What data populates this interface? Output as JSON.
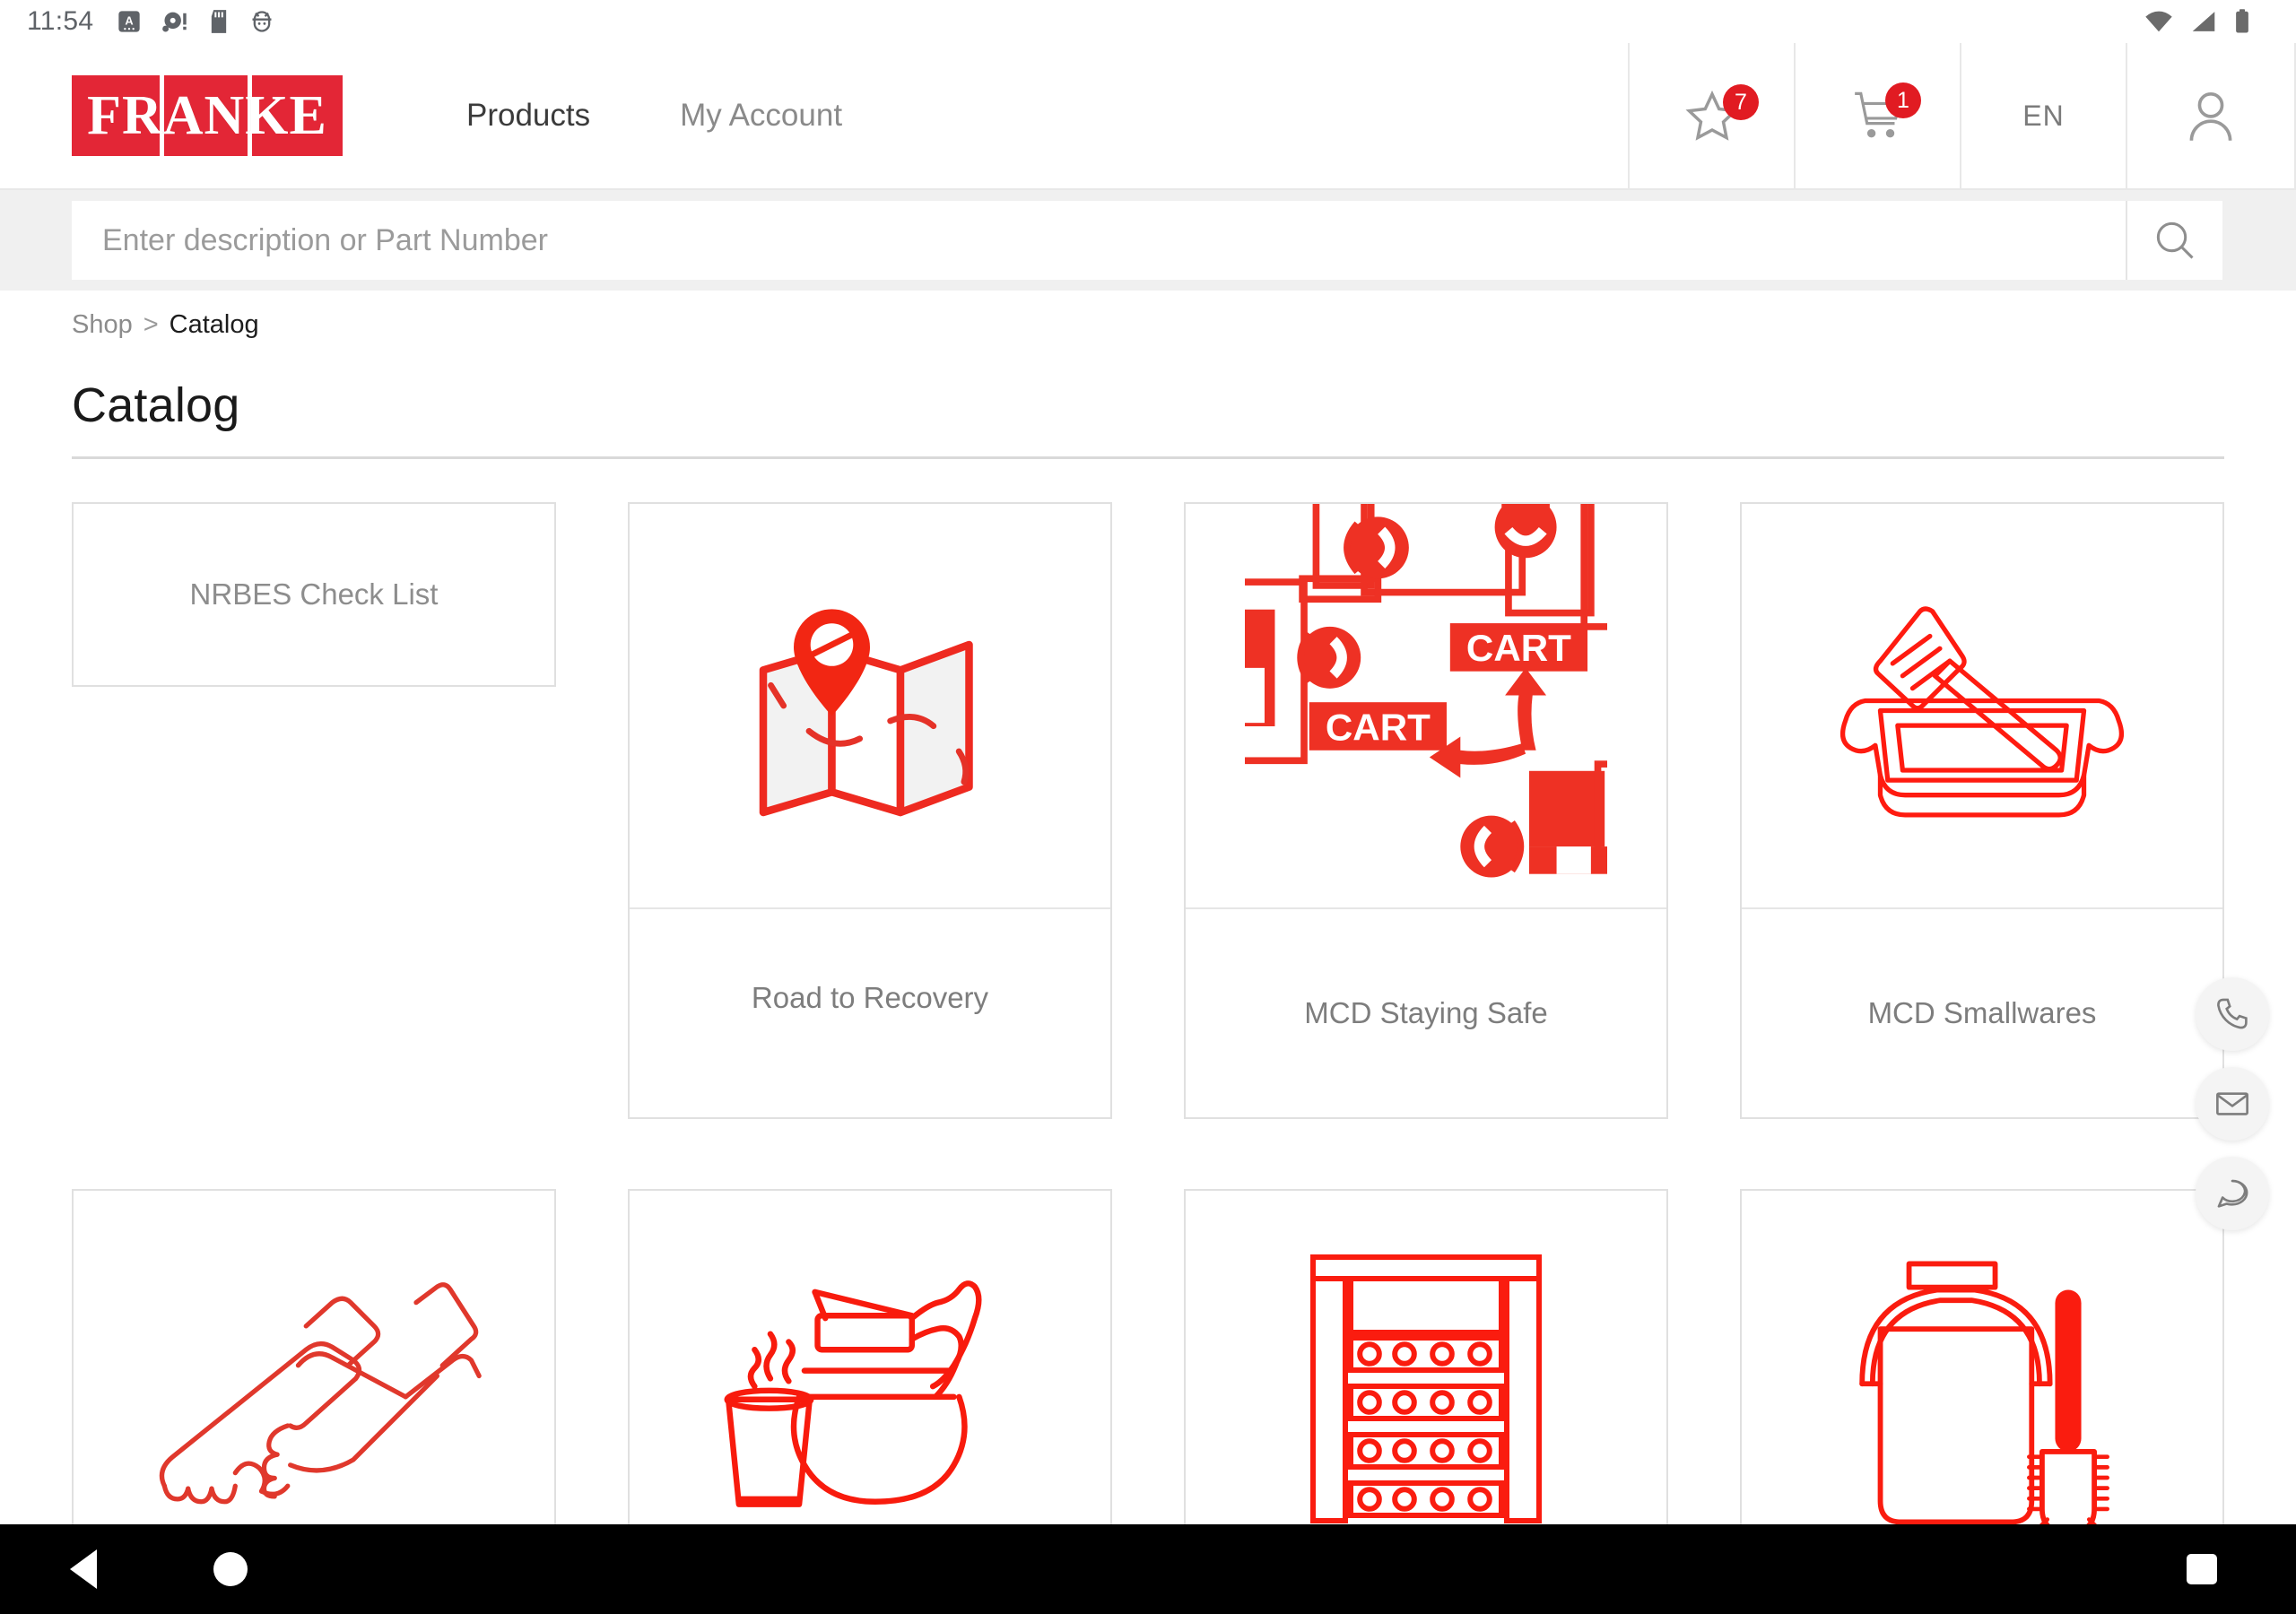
{
  "status_bar": {
    "time": "11:54",
    "left_icons": [
      "text-input-a-icon",
      "record-alert-icon",
      "sd-card-icon",
      "android-debug-icon"
    ],
    "right_icons": [
      "wifi-icon",
      "signal-icon",
      "battery-icon"
    ]
  },
  "header": {
    "logo_text": "FRANKE",
    "nav": [
      {
        "label": "Products",
        "active": true
      },
      {
        "label": "My Account",
        "active": false
      }
    ],
    "favorites": {
      "icon": "star-icon",
      "badge": "7"
    },
    "cart": {
      "icon": "cart-icon",
      "badge": "1"
    },
    "language": {
      "label": "EN",
      "icon": "language-selector"
    },
    "account": {
      "icon": "user-icon"
    }
  },
  "search": {
    "placeholder": "Enter description or Part Number",
    "value": "",
    "button_icon": "search-icon"
  },
  "breadcrumb": {
    "root": "Shop",
    "separator": ">",
    "current": "Catalog"
  },
  "page": {
    "title": "Catalog"
  },
  "cards": [
    {
      "label": "NRBES Check List",
      "icon": "none",
      "type": "text-only"
    },
    {
      "label": "Road to Recovery",
      "icon": "map-pin-icon",
      "type": "image"
    },
    {
      "label": "MCD Staying Safe",
      "icon": "floorplan-cart-icon",
      "type": "image"
    },
    {
      "label": "MCD Smallwares",
      "icon": "spatula-tray-icon",
      "type": "image"
    },
    {
      "label": "",
      "icon": "hand-washing-icon",
      "type": "image"
    },
    {
      "label": "",
      "icon": "coffee-pot-cup-icon",
      "type": "image"
    },
    {
      "label": "",
      "icon": "shelf-rack-icon",
      "type": "image"
    },
    {
      "label": "",
      "icon": "bucket-brush-icon",
      "type": "image"
    }
  ],
  "floating_actions": [
    {
      "icon": "phone-icon",
      "name": "call"
    },
    {
      "icon": "email-icon",
      "name": "email"
    },
    {
      "icon": "chat-icon",
      "name": "chat"
    }
  ],
  "android_nav": {
    "back": "back-button",
    "home": "home-button",
    "recents": "recents-button"
  },
  "colors": {
    "brand_red": "#e32636",
    "icon_red": "#ee2a20",
    "badge_red": "#e11b22",
    "text_dark": "#1a1a1a",
    "text_muted": "#8c8c8c",
    "border": "#e0e0e0",
    "search_bg": "#f0f0f0"
  }
}
